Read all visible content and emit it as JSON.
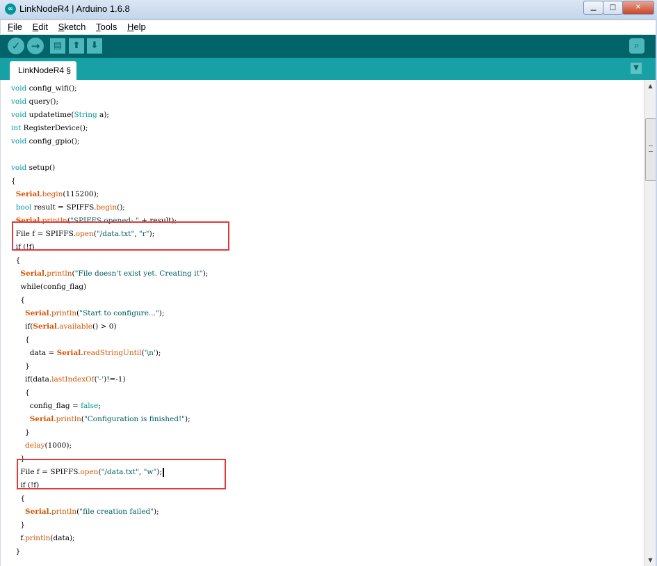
{
  "window": {
    "title": "LinkNodeR4 | Arduino 1.6.8",
    "icon": "∞",
    "min_glyph": "▁",
    "max_glyph": "□",
    "close_glyph": "✕"
  },
  "menu": {
    "file": "File",
    "edit": "Edit",
    "sketch": "Sketch",
    "tools": "Tools",
    "help": "Help"
  },
  "toolbar": {
    "verify_glyph": "✓",
    "upload_glyph": "→",
    "new_glyph": "▤",
    "open_glyph": "⬆",
    "save_glyph": "⬇",
    "serial_glyph": "⌕"
  },
  "tabs": {
    "active": "LinkNodeR4 §",
    "menu_glyph": "▼"
  },
  "colors": {
    "toolbar": "#006468",
    "tabbar": "#17a1a5",
    "keyword": "#00979c",
    "function": "#d35400",
    "highlight_box": "#e03a3a"
  },
  "code_lines": [
    "void config_wifi();",
    "void query();",
    "void updatetime(String a);",
    "int RegisterDevice();",
    "void config_gpio();",
    "",
    "void setup()",
    "{",
    "  Serial.begin(115200);",
    "  bool result = SPIFFS.begin();",
    "  Serial.println(\"SPIFFS opened: \" + result);",
    "  File f = SPIFFS.open(\"/data.txt\", \"r\");",
    "  if (!f)",
    "  {",
    "    Serial.println(\"File doesn't exist yet. Creating it\");",
    "    while(config_flag)",
    "    {",
    "      Serial.println(\"Start to configure...\");",
    "      if(Serial.available() > 0)",
    "      {",
    "        data = Serial.readStringUntil('\\n');",
    "      }",
    "      if(data.lastIndexOf('-')!=-1)",
    "      {",
    "        config_flag = false;",
    "        Serial.println(\"Configuration is finished!\");",
    "      }",
    "      delay(1000);",
    "    }",
    "    File f = SPIFFS.open(\"/data.txt\", \"w\");",
    "    if (!f)",
    "    {",
    "      Serial.println(\"file creation failed\");",
    "    }",
    "    f.println(data);",
    "  }"
  ]
}
